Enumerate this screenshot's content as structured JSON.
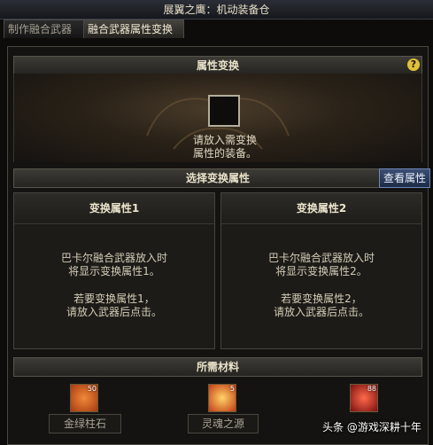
{
  "window_title": "展翼之鹰：机动装备仓",
  "tabs": [
    {
      "label": "制作融合武器"
    },
    {
      "label": "融合武器属性变换"
    }
  ],
  "transform": {
    "header": "属性变换",
    "hint_line1": "请放入需变换",
    "hint_line2": "属性的装备。"
  },
  "select": {
    "header": "选择变换属性",
    "view_button": "查看属性"
  },
  "attr1": {
    "title": "变换属性1",
    "text1": "巴卡尔融合武器放入时\n将显示变换属性1。",
    "text2": "若要变换属性1，\n请放入武器后点击。"
  },
  "attr2": {
    "title": "变换属性2",
    "text1": "巴卡尔融合武器放入时\n将显示变换属性2。",
    "text2": "若要变换属性2，\n请放入武器后点击。"
  },
  "materials": {
    "header": "所需材料",
    "items": [
      {
        "name": "金绿柱石",
        "count": "50",
        "icon": "gem-scroll-icon",
        "color": "#c8521c"
      },
      {
        "name": "灵魂之源",
        "count": "5",
        "icon": "soul-orb-icon",
        "color": "#d4441a"
      },
      {
        "name": "",
        "count": "88",
        "icon": "flame-icon",
        "color": "#b8201a"
      }
    ]
  },
  "watermark": "头条 @游戏深耕十年",
  "help_label": "?"
}
